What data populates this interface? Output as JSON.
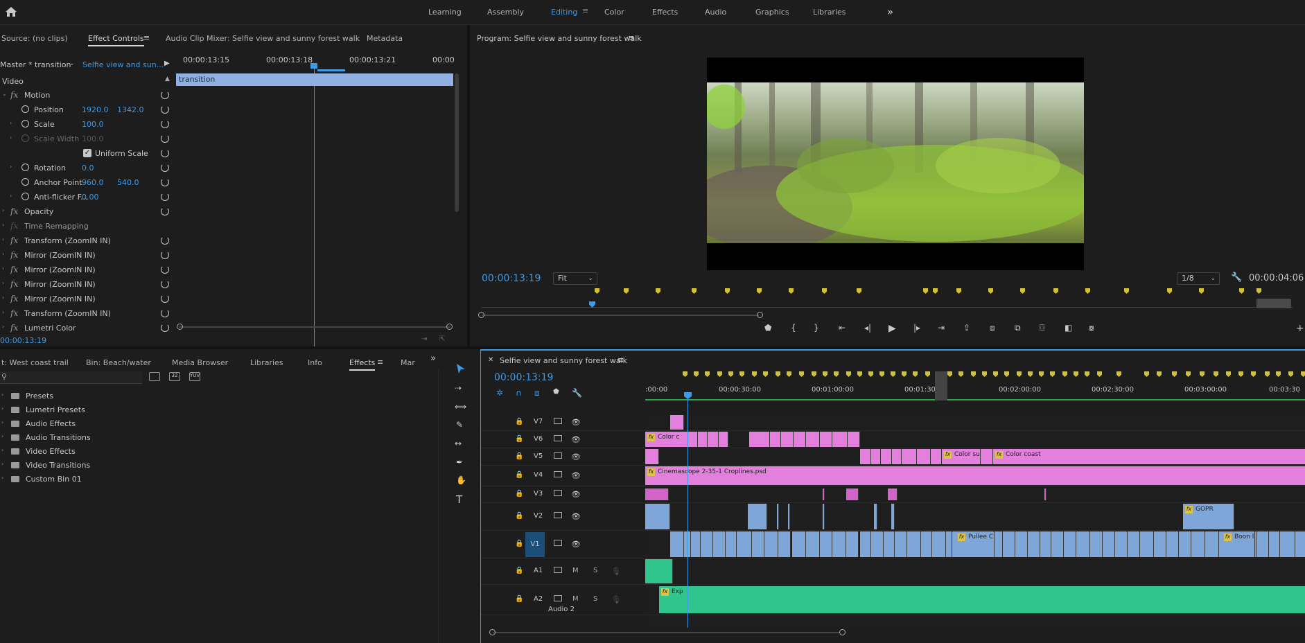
{
  "workspace": {
    "tabs": [
      "Learning",
      "Assembly",
      "Editing",
      "Color",
      "Effects",
      "Audio",
      "Graphics",
      "Libraries"
    ],
    "active": "Editing",
    "more": "»"
  },
  "source_panel": {
    "tabs": [
      "Source: (no clips)",
      "Effect Controls",
      "Audio Clip Mixer: Selfie view and sunny forest walk",
      "Metadata"
    ],
    "active": "Effect Controls",
    "master": "Master * transition",
    "clip": "Selfie view and sun...",
    "times": [
      "00:00:13:15",
      "00:00:13:18",
      "00:00:13:21",
      "00:00"
    ],
    "clip_bar": "transition",
    "section": "Video",
    "timecode": "00:00:13:19",
    "props": [
      {
        "type": "fx",
        "label": "Motion"
      },
      {
        "type": "prop",
        "label": "Position",
        "v1": "1920.0",
        "v2": "1342.0"
      },
      {
        "type": "prop",
        "label": "Scale",
        "v1": "100.0"
      },
      {
        "type": "propdim",
        "label": "Scale Width",
        "v1": "100.0"
      },
      {
        "type": "check",
        "label": "Uniform Scale"
      },
      {
        "type": "prop",
        "label": "Rotation",
        "v1": "0.0"
      },
      {
        "type": "prop",
        "label": "Anchor Point",
        "v1": "960.0",
        "v2": "540.0"
      },
      {
        "type": "prop",
        "label": "Anti-flicker F...",
        "v1": "0.00"
      },
      {
        "type": "fx",
        "label": "Opacity"
      },
      {
        "type": "fxdim",
        "label": "Time Remapping"
      },
      {
        "type": "fx",
        "label": "Transform (ZoomIN IN)"
      },
      {
        "type": "fx",
        "label": "Mirror (ZoomIN IN)"
      },
      {
        "type": "fx",
        "label": "Mirror (ZoomIN IN)"
      },
      {
        "type": "fx",
        "label": "Mirror (ZoomIN IN)"
      },
      {
        "type": "fx",
        "label": "Mirror (ZoomIN IN)"
      },
      {
        "type": "fx",
        "label": "Transform (ZoomIN IN)"
      },
      {
        "type": "fx",
        "label": "Lumetri Color"
      }
    ]
  },
  "program": {
    "title": "Program: Selfie view and sunny forest walk",
    "timecode": "00:00:13:19",
    "fit": "Fit",
    "res": "1/8",
    "duration": "00:00:04:06"
  },
  "project_panel": {
    "tabs": [
      "t: West coast trail",
      "Bin: Beach/water",
      "Media Browser",
      "Libraries",
      "Info",
      "Effects",
      "Mar"
    ],
    "active": "Effects",
    "items": [
      "Presets",
      "Lumetri Presets",
      "Audio Effects",
      "Audio Transitions",
      "Video Effects",
      "Video Transitions",
      "Custom Bin 01"
    ]
  },
  "timeline": {
    "title": "Selfie view and sunny forest walk",
    "timecode": "00:00:13:19",
    "ruler": [
      ":00:00",
      "00:00:30:00",
      "00:01:00:00",
      "00:01:30:00",
      "00:02:00:00",
      "00:02:30:00",
      "00:03:00:00",
      "00:03:30"
    ],
    "tracks": [
      "V7",
      "V6",
      "V5",
      "V4",
      "V3",
      "V2",
      "V1",
      "A1",
      "A2"
    ],
    "audio2_label": "Audio 2",
    "clip_labels": {
      "v6": "Color c",
      "v5a": "Color sun",
      "v5b": "Color coast",
      "v4": "Cinemascope 2-35-1 Croplines.psd",
      "v2": "GOPR",
      "v1a": "Pullee C",
      "v1b": "Boon looking",
      "a2": "Exp"
    }
  }
}
